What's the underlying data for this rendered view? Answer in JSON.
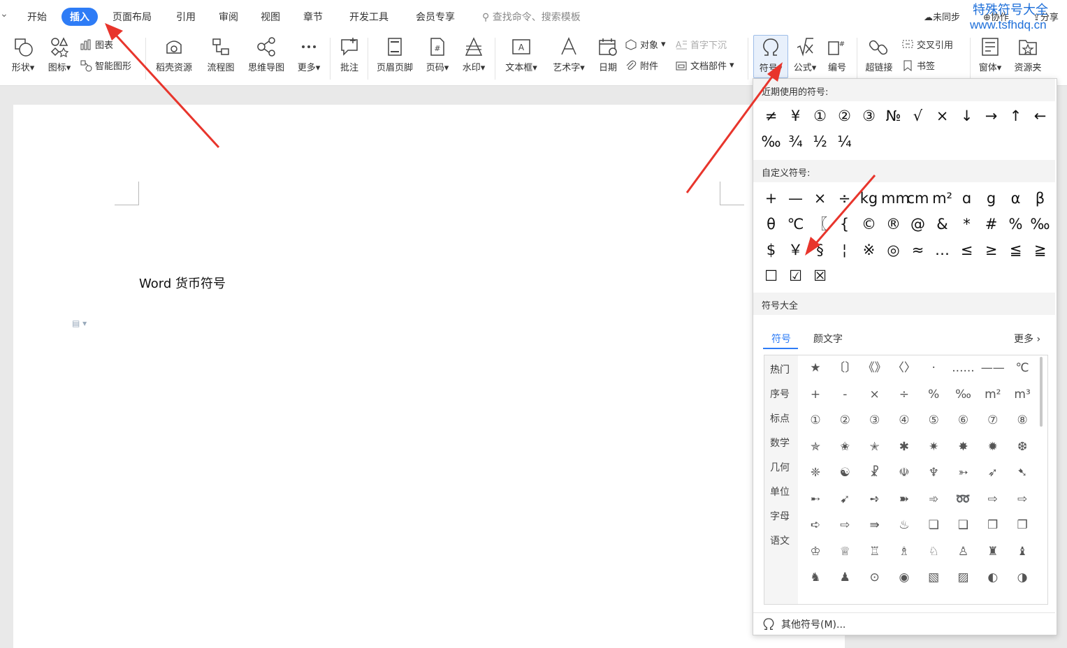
{
  "menubar": {
    "collapse_icon": "chevron-down-icon",
    "tabs": [
      "开始",
      "插入",
      "页面布局",
      "引用",
      "审阅",
      "视图",
      "章节",
      "开发工具",
      "会员专享"
    ],
    "active_tab": "插入",
    "search_placeholder": "查找命令、搜索模板",
    "sync": "未同步",
    "collab": "协作",
    "share": "分享"
  },
  "watermark": {
    "line1": "特殊符号大全",
    "line2": "www.tsfhdq.cn"
  },
  "ribbon": {
    "shape": "形状",
    "icons": "图标",
    "chart": "图表",
    "smart_graphic": "智能图形",
    "docer": "稻壳资源",
    "flowchart": "流程图",
    "mindmap": "思维导图",
    "more": "更多",
    "comment": "批注",
    "header_footer": "页眉页脚",
    "page_number": "页码",
    "watermark": "水印",
    "textbox": "文本框",
    "wordart": "艺术字",
    "date": "日期",
    "object": "对象",
    "dropcap": "首字下沉",
    "attachment": "附件",
    "doc_parts": "文档部件",
    "symbol": "符号",
    "formula": "公式",
    "numbering": "编号",
    "hyperlink": "超链接",
    "cross_ref": "交叉引用",
    "bookmark": "书签",
    "form": "窗体",
    "resource_folder": "资源夹"
  },
  "document": {
    "text": "Word 货币符号"
  },
  "symbol_panel": {
    "recent_title": "近期使用的符号:",
    "recent": [
      "≠",
      "¥",
      "①",
      "②",
      "③",
      "№",
      "√",
      "×",
      "↓",
      "→",
      "↑",
      "←",
      "‰",
      "¾",
      "½",
      "¼"
    ],
    "custom_title": "自定义符号:",
    "custom": [
      "+",
      "—",
      "×",
      "÷",
      "kg",
      "mm",
      "cm",
      "m²",
      "ɑ",
      "g",
      "α",
      "β",
      "θ",
      "℃",
      "〖",
      "{",
      "©",
      "®",
      "@",
      "&",
      "*",
      "#",
      "%",
      "‰",
      "$",
      "￥",
      "§",
      "¦",
      "※",
      "◎",
      "≈",
      "…",
      "≤",
      "≥",
      "≦",
      "≧",
      "☐",
      "☑",
      "☒"
    ],
    "all_title": "符号大全",
    "tabs": [
      "符号",
      "颜文字"
    ],
    "more": "更多",
    "categories": [
      "热门",
      "序号",
      "标点",
      "数学",
      "几何",
      "单位",
      "字母",
      "语文"
    ],
    "grid": [
      "★",
      "〔〕",
      "《》",
      "〈〉",
      "·",
      "......",
      "——",
      "℃",
      "+",
      "-",
      "×",
      "÷",
      "%",
      "‰",
      "m²",
      "m³",
      "①",
      "②",
      "③",
      "④",
      "⑤",
      "⑥",
      "⑦",
      "⑧",
      "✯",
      "✬",
      "✭",
      "✱",
      "✷",
      "✸",
      "✹",
      "❆",
      "❈",
      "☯",
      "☧",
      "☫",
      "♆",
      "➳",
      "➶",
      "➷",
      "➸",
      "➹",
      "➺",
      "➽",
      "➾",
      "➿",
      "⇨",
      "⇨",
      "➪",
      "⇨",
      "⇛",
      "♨",
      "❏",
      "❑",
      "❒",
      "❐",
      "♔",
      "♕",
      "♖",
      "♗",
      "♘",
      "♙",
      "♜",
      "♝",
      "♞",
      "♟",
      "⊙",
      "◉",
      "▧",
      "▨",
      "◐",
      "◑"
    ],
    "other_symbols": "其他符号(M)..."
  },
  "colors": {
    "accent": "#2e7cf6",
    "arrow": "#e8352c",
    "watermark": "#1e6fd9"
  }
}
